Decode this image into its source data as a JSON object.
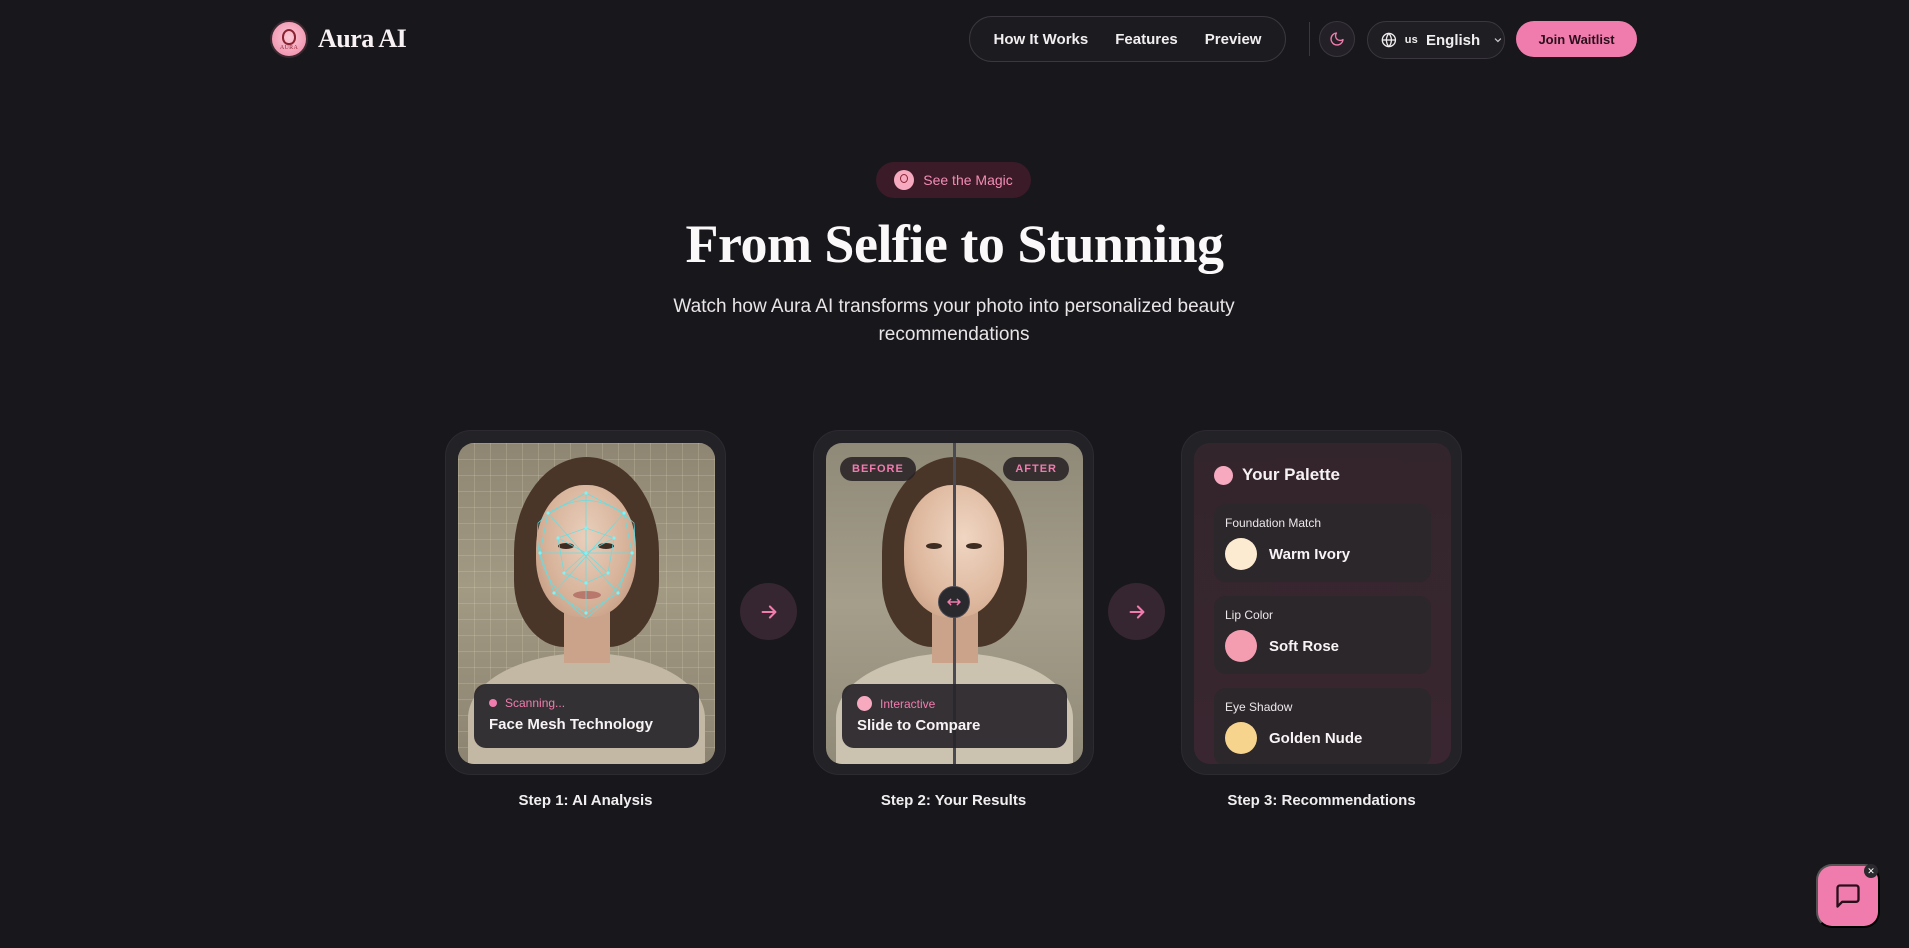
{
  "nav": {
    "brand": "Aura AI",
    "logo_mark_text": "AURA",
    "links": [
      "How It Works",
      "Features",
      "Preview"
    ],
    "theme_icon": "moon-icon",
    "language": {
      "flag": "us",
      "label": "English"
    },
    "cta": "Join Waitlist"
  },
  "hero": {
    "badge": "See the Magic",
    "title": "From Selfie to Stunning",
    "subtitle": "Watch how Aura AI transforms your photo into personalized beauty recommendations"
  },
  "steps": [
    {
      "label": "Step 1: AI Analysis",
      "status": "Scanning...",
      "title": "Face Mesh Technology"
    },
    {
      "label": "Step 2: Your Results",
      "before": "BEFORE",
      "after": "AFTER",
      "status": "Interactive",
      "title": "Slide to Compare"
    },
    {
      "label": "Step 3: Recommendations",
      "palette_title": "Your Palette",
      "items": [
        {
          "label": "Foundation Match",
          "value": "Warm Ivory",
          "color": "#fcebd0"
        },
        {
          "label": "Lip Color",
          "value": "Soft Rose",
          "color": "#f49cb0"
        },
        {
          "label": "Eye Shadow",
          "value": "Golden Nude",
          "color": "#f7d48e"
        }
      ]
    }
  ],
  "colors": {
    "accent": "#f07cae",
    "background": "#18171b"
  }
}
